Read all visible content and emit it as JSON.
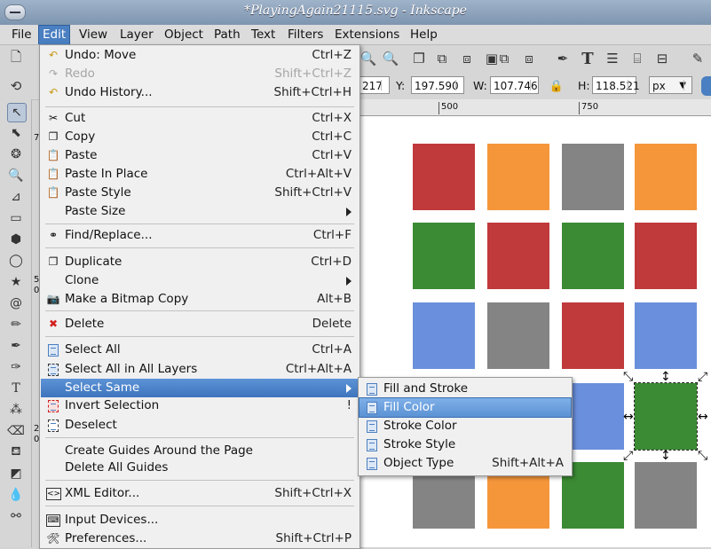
{
  "window": {
    "title": "*PlayingAgain21115.svg - Inkscape"
  },
  "menubar": {
    "items": [
      {
        "label": "File",
        "ul": 0
      },
      {
        "label": "Edit",
        "ul": 0
      },
      {
        "label": "View",
        "ul": 0
      },
      {
        "label": "Layer",
        "ul": 0
      },
      {
        "label": "Object",
        "ul": 0
      },
      {
        "label": "Path",
        "ul": 0
      },
      {
        "label": "Text",
        "ul": 0
      },
      {
        "label": "Filters",
        "ul": 0
      },
      {
        "label": "Extensions",
        "ul": 0
      },
      {
        "label": "Help",
        "ul": 0
      }
    ]
  },
  "controls": {
    "x_value": "217",
    "y_label": "Y:",
    "y_value": "197.590",
    "w_label": "W:",
    "w_value": "107.746",
    "h_label": "H:",
    "h_value": "118.521",
    "unit": "px"
  },
  "ruler": {
    "ticks": [
      "500",
      "750"
    ]
  },
  "toolbox_labels": [
    "7",
    "5",
    "0",
    "5",
    "2",
    "0"
  ],
  "edit_menu": {
    "undo": {
      "label": "Undo: Move",
      "shortcut": "Ctrl+Z"
    },
    "redo": {
      "label": "Redo",
      "shortcut": "Shift+Ctrl+Z"
    },
    "undo_history": {
      "label": "Undo History...",
      "shortcut": "Shift+Ctrl+H"
    },
    "cut": {
      "label": "Cut",
      "shortcut": "Ctrl+X"
    },
    "copy": {
      "label": "Copy",
      "shortcut": "Ctrl+C"
    },
    "paste": {
      "label": "Paste",
      "shortcut": "Ctrl+V"
    },
    "paste_in_place": {
      "label": "Paste In Place",
      "shortcut": "Ctrl+Alt+V"
    },
    "paste_style": {
      "label": "Paste Style",
      "shortcut": "Shift+Ctrl+V"
    },
    "paste_size": {
      "label": "Paste Size"
    },
    "find_replace": {
      "label": "Find/Replace...",
      "shortcut": "Ctrl+F"
    },
    "duplicate": {
      "label": "Duplicate",
      "shortcut": "Ctrl+D"
    },
    "clone": {
      "label": "Clone"
    },
    "bitmap_copy": {
      "label": "Make a Bitmap Copy",
      "shortcut": "Alt+B"
    },
    "delete": {
      "label": "Delete",
      "shortcut": "Delete"
    },
    "select_all": {
      "label": "Select All",
      "shortcut": "Ctrl+A"
    },
    "select_all_layers": {
      "label": "Select All in All Layers",
      "shortcut": "Ctrl+Alt+A"
    },
    "select_same": {
      "label": "Select Same"
    },
    "invert_selection": {
      "label": "Invert Selection",
      "shortcut": "!"
    },
    "deselect": {
      "label": "Deselect"
    },
    "create_guides": {
      "label": "Create Guides Around the Page"
    },
    "delete_guides": {
      "label": "Delete All Guides"
    },
    "xml_editor": {
      "label": "XML Editor...",
      "shortcut": "Shift+Ctrl+X"
    },
    "input_devices": {
      "label": "Input Devices..."
    },
    "preferences": {
      "label": "Preferences...",
      "shortcut": "Shift+Ctrl+P"
    }
  },
  "select_same_menu": {
    "fill_and_stroke": {
      "label": "Fill and Stroke"
    },
    "fill_color": {
      "label": "Fill Color"
    },
    "stroke_color": {
      "label": "Stroke Color"
    },
    "stroke_style": {
      "label": "Stroke Style"
    },
    "object_type": {
      "label": "Object Type",
      "shortcut": "Shift+Alt+A"
    }
  },
  "colors": {
    "red": "#c0393b",
    "orange": "#f5963a",
    "gray": "#848484",
    "green": "#3b8a34",
    "blue": "#6a8fdc",
    "highlight": "#3d74bd"
  },
  "canvas": {
    "grid": [
      [
        "red",
        "orange",
        "gray",
        "orange"
      ],
      [
        "green",
        "red",
        "green",
        "red"
      ],
      [
        "blue",
        "gray",
        "red",
        "blue"
      ],
      [
        "",
        "",
        "blue",
        "green"
      ],
      [
        "gray",
        "orange",
        "green",
        "gray"
      ]
    ]
  }
}
